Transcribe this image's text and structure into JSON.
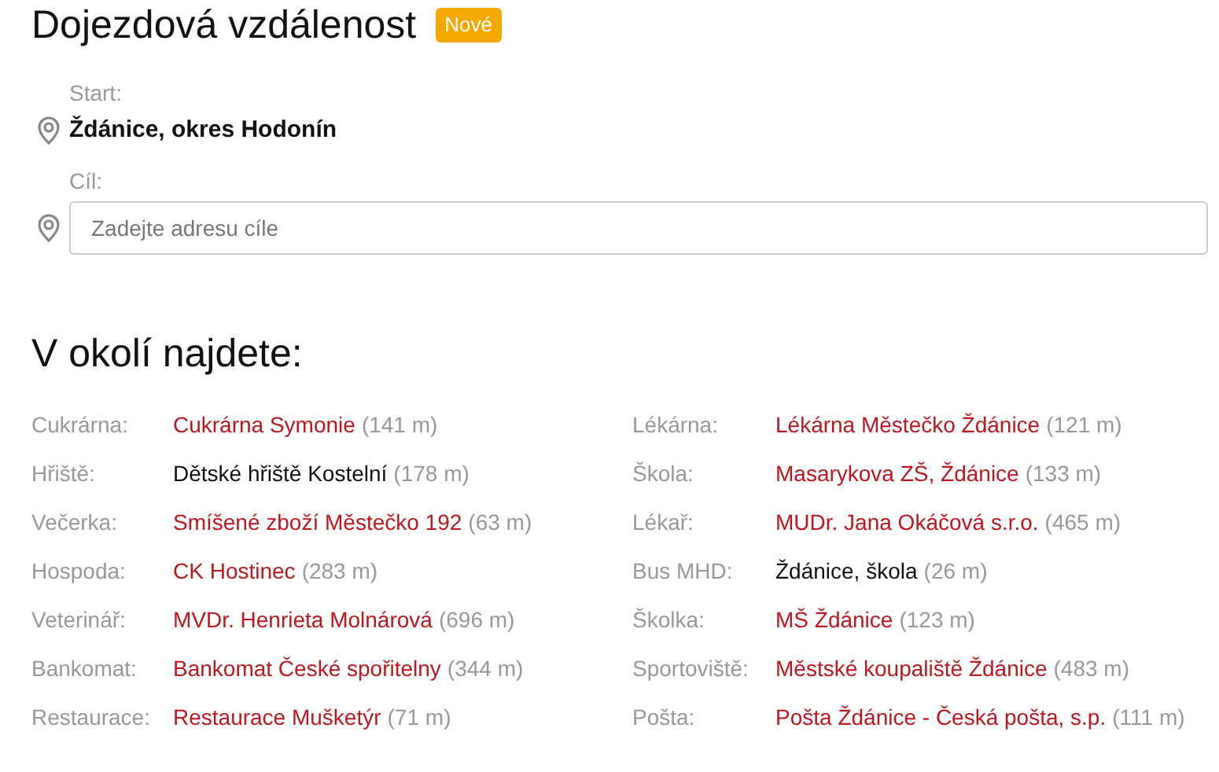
{
  "title": "Dojezdová vzdálenost",
  "badge": "Nové",
  "start": {
    "label": "Start:",
    "value": "Ždánice, okres Hodonín"
  },
  "destination": {
    "label": "Cíl:",
    "placeholder": "Zadejte adresu cíle"
  },
  "nearby": {
    "heading": "V okolí najdete:",
    "columns": [
      [
        {
          "category": "Cukrárna:",
          "name": "Cukrárna Symonie",
          "distance": "(141 m)",
          "link": true
        },
        {
          "category": "Hřiště:",
          "name": "Dětské hřiště Kostelní",
          "distance": "(178 m)",
          "link": false
        },
        {
          "category": "Večerka:",
          "name": "Smíšené zboží Městečko 192",
          "distance": "(63 m)",
          "link": true
        },
        {
          "category": "Hospoda:",
          "name": "CK Hostinec",
          "distance": "(283 m)",
          "link": true
        },
        {
          "category": "Veterinář:",
          "name": "MVDr. Henrieta Molnárová",
          "distance": "(696 m)",
          "link": true
        },
        {
          "category": "Bankomat:",
          "name": "Bankomat České spořitelny",
          "distance": "(344 m)",
          "link": true
        },
        {
          "category": "Restaurace:",
          "name": "Restaurace Mušketýr",
          "distance": "(71 m)",
          "link": true
        }
      ],
      [
        {
          "category": "Lékárna:",
          "name": "Lékárna Městečko Ždánice",
          "distance": "(121 m)",
          "link": true
        },
        {
          "category": "Škola:",
          "name": "Masarykova ZŠ, Ždánice",
          "distance": "(133 m)",
          "link": true
        },
        {
          "category": "Lékař:",
          "name": "MUDr. Jana Okáčová s.r.o.",
          "distance": "(465 m)",
          "link": true
        },
        {
          "category": "Bus MHD:",
          "name": "Ždánice, škola",
          "distance": "(26 m)",
          "link": false
        },
        {
          "category": "Školka:",
          "name": "MŠ Ždánice",
          "distance": "(123 m)",
          "link": true
        },
        {
          "category": "Sportoviště:",
          "name": "Městské koupaliště Ždánice",
          "distance": "(483 m)",
          "link": true
        },
        {
          "category": "Pošta:",
          "name": "Pošta Ždánice - Česká pošta, s.p.",
          "distance": "(111 m)",
          "link": true
        }
      ]
    ]
  }
}
